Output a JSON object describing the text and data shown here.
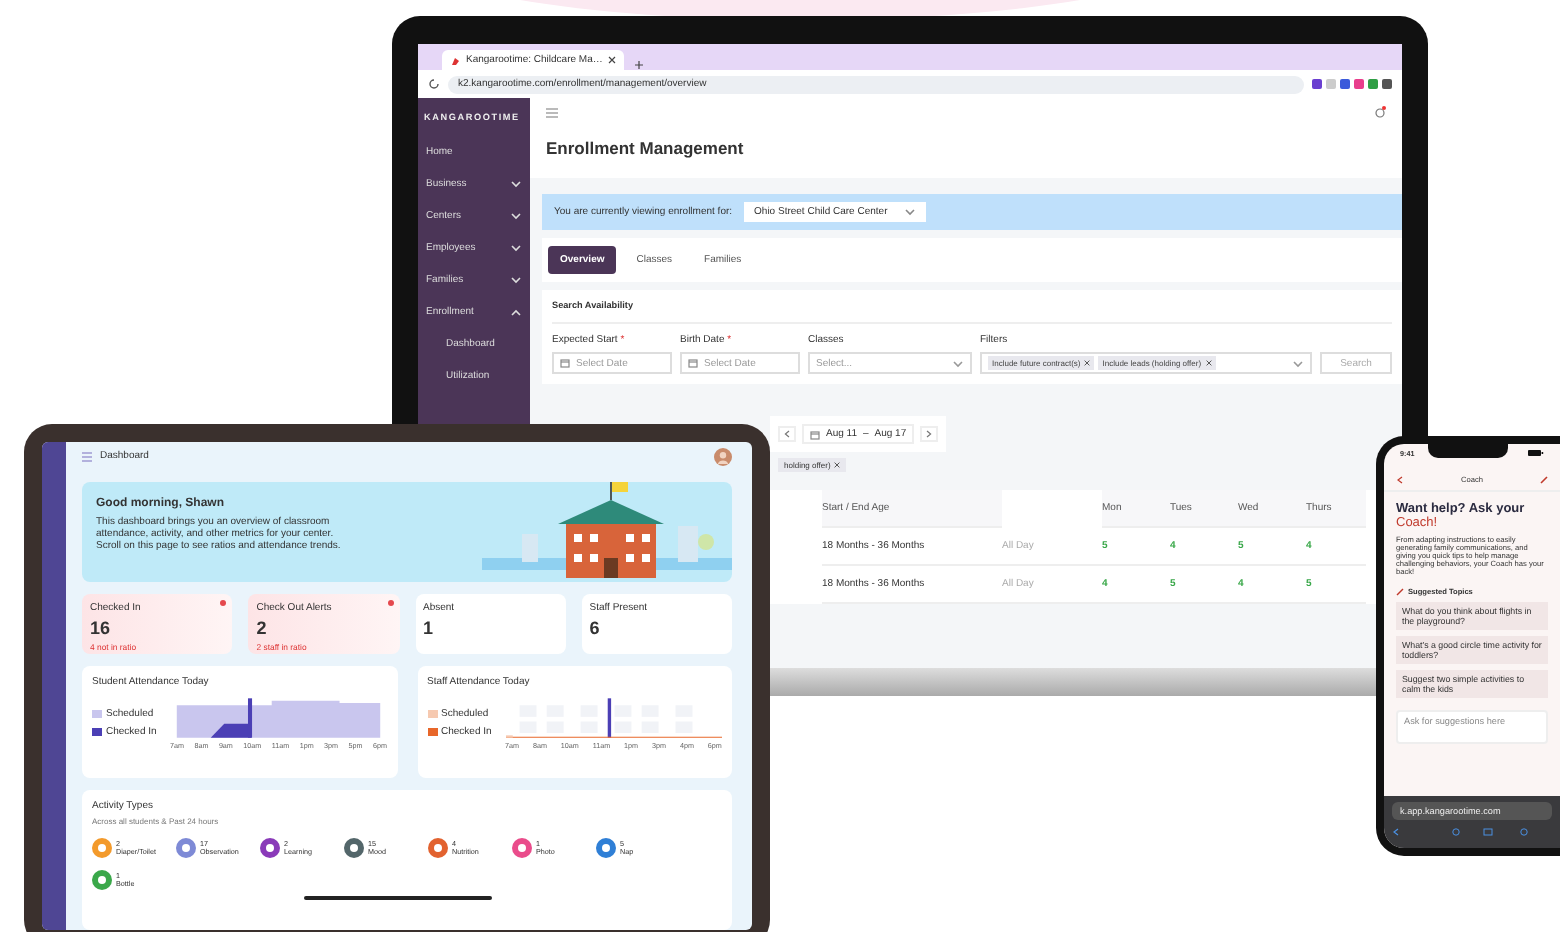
{
  "laptop": {
    "browser_tab": "Kangarootime: Childcare Ma…",
    "url": "k2.kangarootime.com/enrollment/management/overview",
    "brand": "KANGAROOTIME",
    "sidebar": [
      {
        "label": "Home",
        "kind": "link"
      },
      {
        "label": "Business",
        "kind": "group",
        "expanded": false
      },
      {
        "label": "Centers",
        "kind": "group",
        "expanded": false
      },
      {
        "label": "Employees",
        "kind": "group",
        "expanded": false
      },
      {
        "label": "Families",
        "kind": "group",
        "expanded": false
      },
      {
        "label": "Enrollment",
        "kind": "group",
        "expanded": true,
        "children": [
          {
            "label": "Dashboard"
          },
          {
            "label": "Utilization"
          }
        ]
      }
    ],
    "title": "Enrollment Management",
    "banner_text": "You are currently viewing enrollment for:",
    "center": "Ohio Street Child Care Center",
    "tabs": [
      {
        "label": "Overview",
        "selected": true
      },
      {
        "label": "Classes",
        "selected": false
      },
      {
        "label": "Families",
        "selected": false
      }
    ],
    "section_title": "Search Availability",
    "fields": [
      {
        "label": "Expected Start",
        "required_mark": "*",
        "kind": "date",
        "placeholder": "Select Date"
      },
      {
        "label": "Birth Date",
        "required_mark": "*",
        "kind": "date",
        "placeholder": "Select Date"
      },
      {
        "label": "Classes",
        "kind": "select",
        "placeholder": "Select..."
      },
      {
        "label": "Filters",
        "kind": "tags",
        "tags": [
          "Include future contract(s)",
          "Include leads (holding offer)"
        ]
      }
    ],
    "search_button": "Search",
    "week_start": "Aug 11",
    "week_sep": "–",
    "week_end": "Aug 17",
    "chip": "holding offer)",
    "table": {
      "columns": [
        "Start / End Age",
        "Mon",
        "Tues",
        "Wed",
        "Thurs"
      ],
      "rows": [
        {
          "age": "18 Months - 36 Months",
          "schedule": "All Day",
          "counts": [
            "5",
            "4",
            "5",
            "4"
          ]
        },
        {
          "age": "18 Months - 36 Months",
          "schedule": "All Day",
          "counts": [
            "4",
            "5",
            "4",
            "5"
          ]
        }
      ]
    }
  },
  "tablet": {
    "header": "Dashboard",
    "greeting": "Good morning, Shawn",
    "intro": "This dashboard brings you an overview of classroom attendance, activity, and other metrics for your center. Scroll on this page to see ratios and attendance trends.",
    "stats": [
      {
        "label": "Checked In",
        "value": "16",
        "note": "4 not in ratio",
        "alert": true
      },
      {
        "label": "Check Out Alerts",
        "value": "2",
        "note": "2 staff in ratio",
        "alert": true
      },
      {
        "label": "Absent",
        "value": "1",
        "alert": false
      },
      {
        "label": "Staff Present",
        "value": "6",
        "alert": false
      }
    ],
    "charts": [
      {
        "title": "Student Attendance Today",
        "kind": "area",
        "legend": [
          {
            "label": "Scheduled",
            "color": "#c9c6ee"
          },
          {
            "label": "Checked In",
            "color": "#4b3fb5"
          }
        ],
        "x_labels": [
          "7am",
          "8am",
          "9am",
          "10am",
          "11am",
          "1pm",
          "3pm",
          "5pm",
          "6pm"
        ]
      },
      {
        "title": "Staff Attendance Today",
        "kind": "bars",
        "legend": [
          {
            "label": "Scheduled",
            "color": "#f6c9b0"
          },
          {
            "label": "Checked In",
            "color": "#e8672a"
          }
        ],
        "x_labels": [
          "7am",
          "8am",
          "10am",
          "11am",
          "1pm",
          "3pm",
          "4pm",
          "6pm"
        ]
      }
    ],
    "activity_title": "Activity Types",
    "activity_subtitle": "Across all students & Past 24 hours",
    "activities": [
      {
        "count": "2",
        "label": "Diaper/Toilet",
        "color": "#f39a2b"
      },
      {
        "count": "17",
        "label": "Observation",
        "color": "#7e8ad6"
      },
      {
        "count": "2",
        "label": "Learning",
        "color": "#8a3ab9"
      },
      {
        "count": "15",
        "label": "Mood",
        "color": "#53666a"
      },
      {
        "count": "4",
        "label": "Nutrition",
        "color": "#e2622f"
      },
      {
        "count": "1",
        "label": "Photo",
        "color": "#ea4c8b"
      },
      {
        "count": "5",
        "label": "Nap",
        "color": "#2f7fd6"
      },
      {
        "count": "1",
        "label": "Bottle",
        "color": "#3aa84a"
      }
    ]
  },
  "phone": {
    "time": "9:41",
    "title": "Coach",
    "heading": "Want help? Ask your",
    "heading_accent": "Coach!",
    "intro": "From adapting instructions to easily generating family communications, and giving you quick tips to help manage challenging behaviors, your Coach has your back!",
    "topics_title": "Suggested Topics",
    "topics": [
      "What do you think about flights in the playground?",
      "What's a good circle time activity for toddlers?",
      "Suggest two simple activities to calm the kids"
    ],
    "input_placeholder": "Ask for suggestions here",
    "url": "k.app.kangarootime.com"
  }
}
